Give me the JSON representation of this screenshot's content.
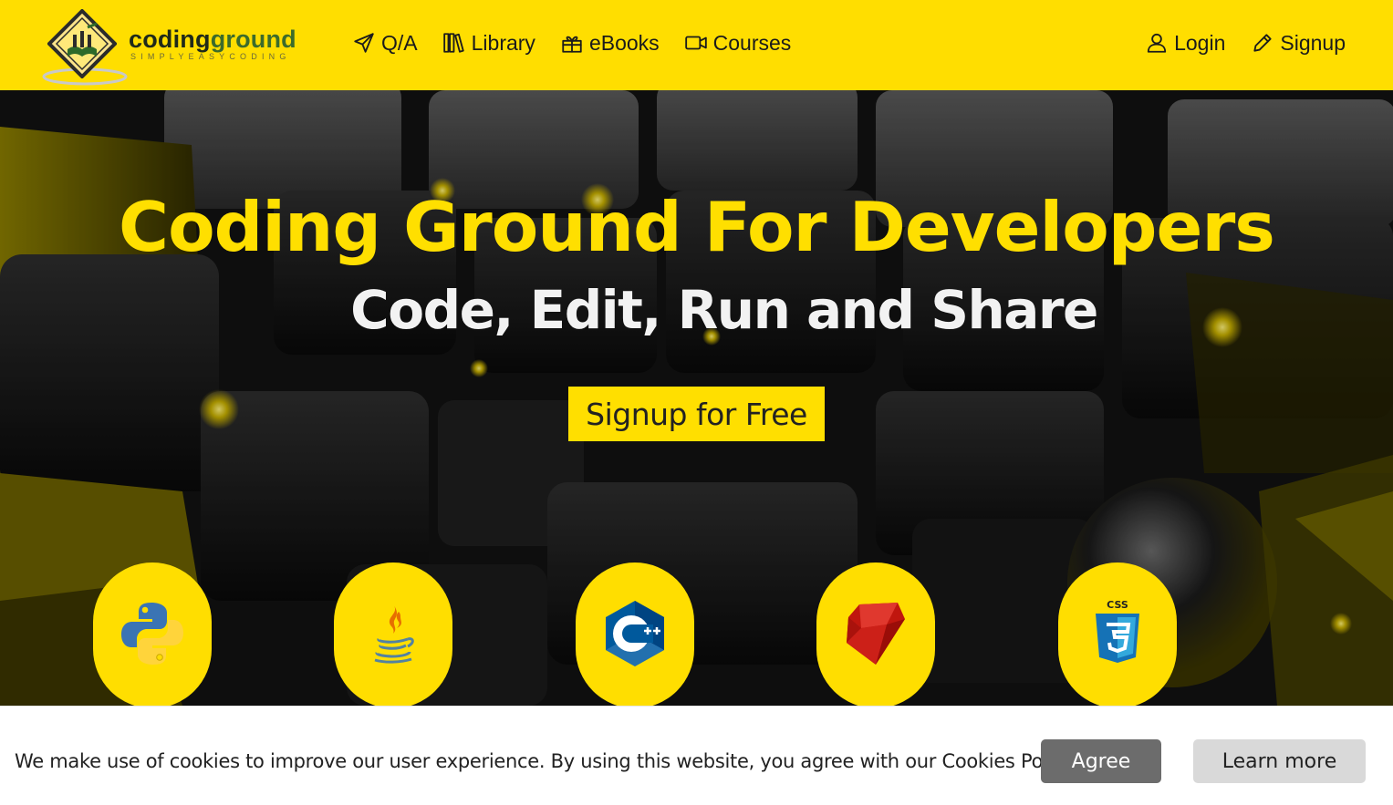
{
  "brand": {
    "name_part1": "coding",
    "name_part2": "ground",
    "tagline": "SIMPLYEASYCODING",
    "logo_icon": "book-diamond-logo"
  },
  "nav": {
    "left": [
      {
        "label": "Q/A",
        "icon": "paper-plane-icon"
      },
      {
        "label": "Library",
        "icon": "library-icon"
      },
      {
        "label": "eBooks",
        "icon": "gift-box-icon"
      },
      {
        "label": "Courses",
        "icon": "video-camera-icon"
      }
    ],
    "right": [
      {
        "label": "Login",
        "icon": "user-icon"
      },
      {
        "label": "Signup",
        "icon": "pencil-icon"
      }
    ]
  },
  "hero": {
    "title": "Coding Ground For Developers",
    "subtitle": "Code, Edit, Run and Share",
    "cta_label": "Signup for Free"
  },
  "languages": [
    {
      "name": "Python",
      "icon": "python-icon"
    },
    {
      "name": "Java",
      "icon": "java-icon"
    },
    {
      "name": "C++",
      "icon": "cpp-icon"
    },
    {
      "name": "Ruby",
      "icon": "ruby-icon"
    },
    {
      "name": "CSS",
      "icon": "css3-icon"
    }
  ],
  "cookie": {
    "message": "We make use of cookies to improve our user experience. By using this website, you agree with our Cookies Policy.",
    "agree_label": "Agree",
    "learn_more_label": "Learn more"
  },
  "colors": {
    "brand_yellow": "#ffde00",
    "agree_button": "#6c6c6c",
    "learn_more_button": "#d9d9d9",
    "hero_title": "#ffdf00"
  }
}
